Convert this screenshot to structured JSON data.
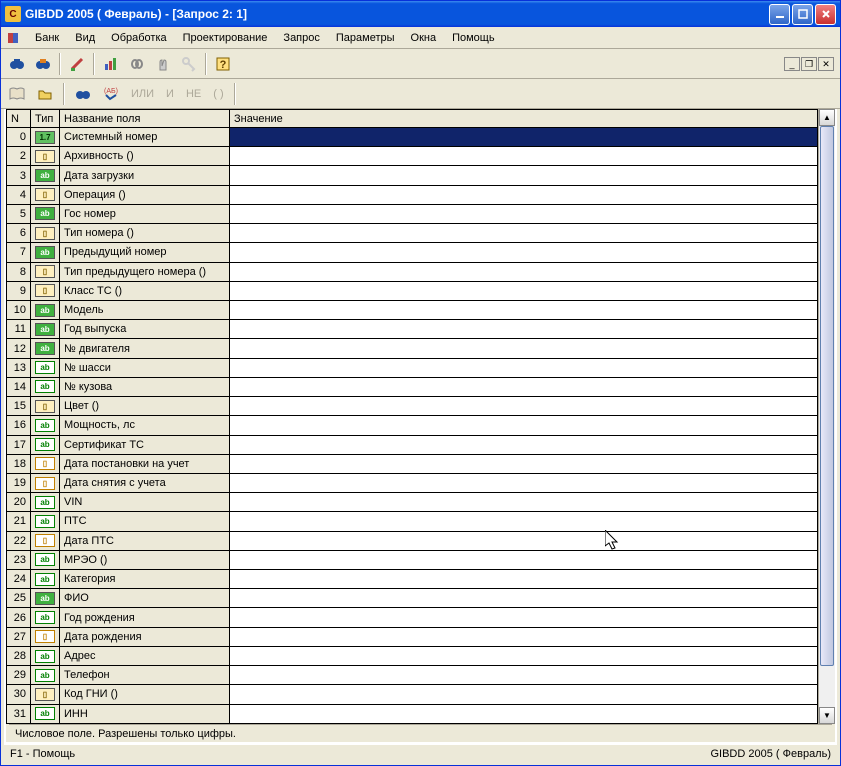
{
  "title": "GIBDD 2005 ( Февраль) - [Запрос 2: 1]",
  "menu": [
    "Банк",
    "Вид",
    "Обработка",
    "Проектирование",
    "Запрос",
    "Параметры",
    "Окна",
    "Помощь"
  ],
  "toolbar2_labels": {
    "ili": "ИЛИ",
    "i": "И",
    "ne": "НЕ",
    "paren": "( )"
  },
  "columns": {
    "n": "N",
    "type": "Тип",
    "field": "Название поля",
    "value": "Значение"
  },
  "rows": [
    {
      "n": 0,
      "type": "num",
      "type_label": "1.7",
      "field": "Системный номер",
      "value": "",
      "selected": true
    },
    {
      "n": 2,
      "type": "book",
      "type_label": "▯",
      "field": "Архивность ()",
      "value": ""
    },
    {
      "n": 3,
      "type": "ab-g",
      "type_label": "ab",
      "field": "Дата загрузки",
      "value": ""
    },
    {
      "n": 4,
      "type": "book",
      "type_label": "▯",
      "field": "Операция ()",
      "value": ""
    },
    {
      "n": 5,
      "type": "ab-g",
      "type_label": "ab",
      "field": "Гос номер",
      "value": ""
    },
    {
      "n": 6,
      "type": "book",
      "type_label": "▯",
      "field": "Тип номера ()",
      "value": ""
    },
    {
      "n": 7,
      "type": "ab-g",
      "type_label": "ab",
      "field": "Предыдущий номер",
      "value": ""
    },
    {
      "n": 8,
      "type": "book",
      "type_label": "▯",
      "field": "Тип предыдущего номера ()",
      "value": ""
    },
    {
      "n": 9,
      "type": "book",
      "type_label": "▯",
      "field": "Класс ТС ()",
      "value": ""
    },
    {
      "n": 10,
      "type": "ab-g",
      "type_label": "ab",
      "field": "Модель",
      "value": ""
    },
    {
      "n": 11,
      "type": "ab-g",
      "type_label": "ab",
      "field": "Год выпуска",
      "value": ""
    },
    {
      "n": 12,
      "type": "ab-g",
      "type_label": "ab",
      "field": "№ двигателя",
      "value": ""
    },
    {
      "n": 13,
      "type": "ab",
      "type_label": "ab",
      "field": "№ шасси",
      "value": ""
    },
    {
      "n": 14,
      "type": "ab",
      "type_label": "ab",
      "field": "№ кузова",
      "value": ""
    },
    {
      "n": 15,
      "type": "book",
      "type_label": "▯",
      "field": "Цвет ()",
      "value": ""
    },
    {
      "n": 16,
      "type": "ab",
      "type_label": "ab",
      "field": "Мощность, лс",
      "value": ""
    },
    {
      "n": 17,
      "type": "ab",
      "type_label": "ab",
      "field": "Сертификат ТС",
      "value": ""
    },
    {
      "n": 18,
      "type": "date",
      "type_label": "▯",
      "field": "Дата постановки на учет",
      "value": ""
    },
    {
      "n": 19,
      "type": "date",
      "type_label": "▯",
      "field": "Дата снятия с учета",
      "value": ""
    },
    {
      "n": 20,
      "type": "ab",
      "type_label": "ab",
      "field": "VIN",
      "value": ""
    },
    {
      "n": 21,
      "type": "ab",
      "type_label": "ab",
      "field": "ПТС",
      "value": ""
    },
    {
      "n": 22,
      "type": "date",
      "type_label": "▯",
      "field": "Дата ПТС",
      "value": ""
    },
    {
      "n": 23,
      "type": "ab",
      "type_label": "ab",
      "field": "МРЭО ()",
      "value": ""
    },
    {
      "n": 24,
      "type": "ab",
      "type_label": "ab",
      "field": "Категория",
      "value": ""
    },
    {
      "n": 25,
      "type": "ab-g",
      "type_label": "ab",
      "field": "ФИО",
      "value": ""
    },
    {
      "n": 26,
      "type": "ab",
      "type_label": "ab",
      "field": "Год рождения",
      "value": ""
    },
    {
      "n": 27,
      "type": "date",
      "type_label": "▯",
      "field": "Дата рождения",
      "value": ""
    },
    {
      "n": 28,
      "type": "ab",
      "type_label": "ab",
      "field": "Адрес",
      "value": ""
    },
    {
      "n": 29,
      "type": "ab",
      "type_label": "ab",
      "field": "Телефон",
      "value": ""
    },
    {
      "n": 30,
      "type": "book",
      "type_label": "▯",
      "field": "Код ГНИ ()",
      "value": ""
    },
    {
      "n": 31,
      "type": "ab",
      "type_label": "ab",
      "field": "ИНН",
      "value": ""
    }
  ],
  "status1": "Числовое поле. Разрешены только цифры.",
  "status2_left": "F1 - Помощь",
  "status2_right": "GIBDD 2005 ( Февраль)"
}
